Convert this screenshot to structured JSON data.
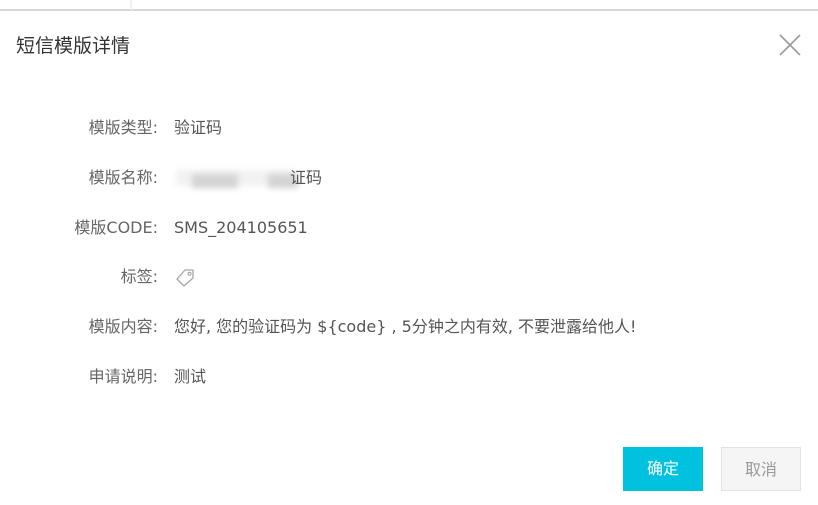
{
  "dialog": {
    "title": "短信模版详情"
  },
  "fields": [
    {
      "label": "模版类型:",
      "value": "验证码"
    },
    {
      "label": "模版名称:",
      "value": "证码"
    },
    {
      "label": "模版CODE:",
      "value": "SMS_204105651"
    },
    {
      "label": "标签:",
      "value": ""
    },
    {
      "label": "模版内容:",
      "value": "您好, 您的验证码为 ${code} , 5分钟之内有效, 不要泄露给他人!"
    },
    {
      "label": "申请说明:",
      "value": "测试"
    }
  ],
  "buttons": {
    "confirm": "确定",
    "cancel": "取消"
  },
  "colors": {
    "primary": "#00c1de",
    "label": "#666666",
    "value": "#555555"
  },
  "icons": {
    "close": "close-icon",
    "tag": "tag-icon"
  }
}
